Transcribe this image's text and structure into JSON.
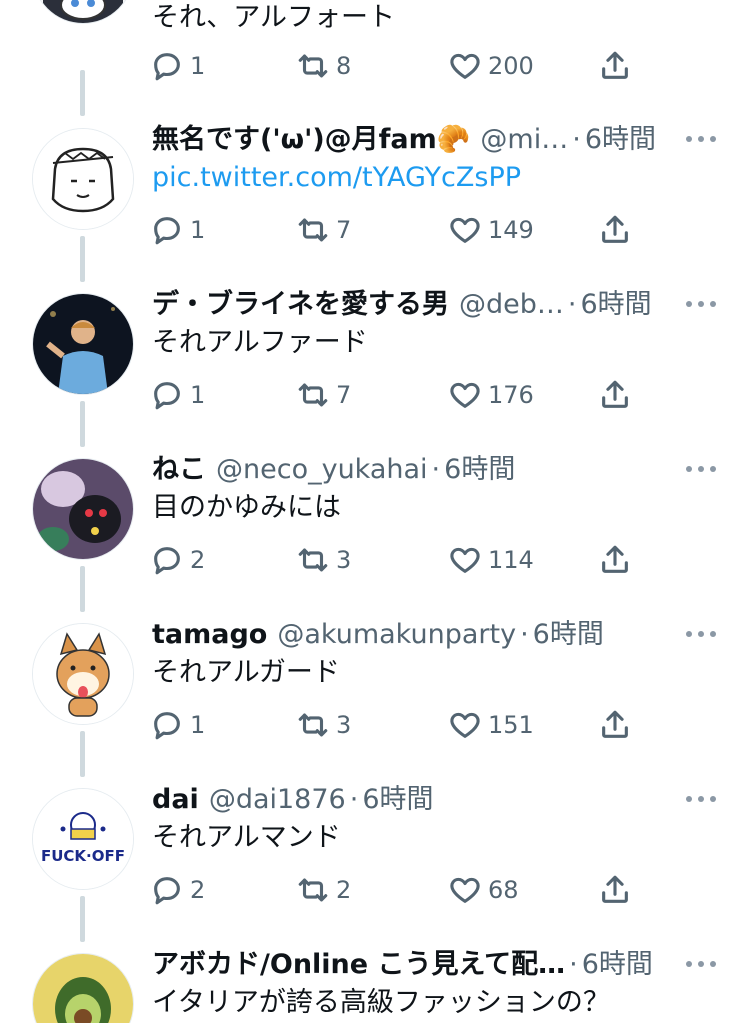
{
  "tweets": [
    {
      "name": "",
      "handle": "",
      "time": "",
      "text": "それ、アルフォート",
      "reply_count": "1",
      "retweet_count": "8",
      "like_count": "200"
    },
    {
      "name": "無名です('ω')@月fam🥐",
      "handle": "@mi…",
      "time": "6時間",
      "text": "pic.twitter.com/tYAGYcZsPP",
      "reply_count": "1",
      "retweet_count": "7",
      "like_count": "149"
    },
    {
      "name": "デ・ブライネを愛する男",
      "handle": "@deb…",
      "time": "6時間",
      "text": "それアルファード",
      "reply_count": "1",
      "retweet_count": "7",
      "like_count": "176"
    },
    {
      "name": "ねこ",
      "handle": "@neco_yukahai",
      "time": "6時間",
      "text": "目のかゆみには",
      "reply_count": "2",
      "retweet_count": "3",
      "like_count": "114"
    },
    {
      "name": "tamago",
      "handle": "@akumakunparty",
      "time": "6時間",
      "text": "それアルガード",
      "reply_count": "1",
      "retweet_count": "3",
      "like_count": "151"
    },
    {
      "name": "dai",
      "handle": "@dai1876",
      "time": "6時間",
      "text": "それアルマンド",
      "reply_count": "2",
      "retweet_count": "2",
      "like_count": "68"
    },
    {
      "name": "アボカド/Online こう見えて配…",
      "handle": "",
      "time": "6時間",
      "text": "イタリアが誇る高級ファッションの？",
      "reply_count": "",
      "retweet_count": "",
      "like_count": ""
    }
  ],
  "avatar_badge_text": "FUCK·OFF",
  "colors": {
    "link": "#1d9bf0",
    "secondary_text": "#536471",
    "thread_line": "#cfd9de"
  },
  "icons": [
    "reply-icon",
    "retweet-icon",
    "like-icon",
    "share-icon",
    "more-icon"
  ]
}
